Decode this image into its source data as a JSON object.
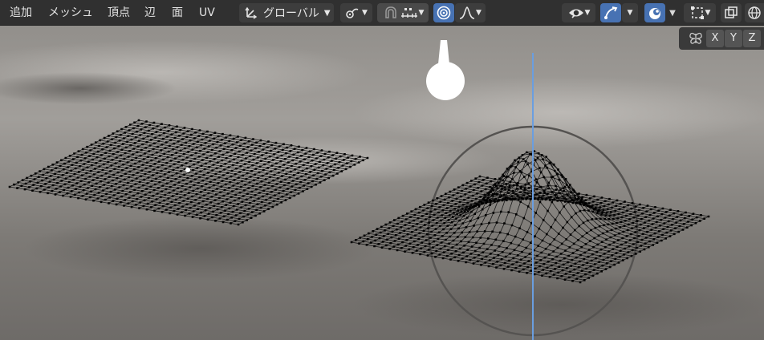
{
  "menu": {
    "add": "追加",
    "mesh": "メッシュ",
    "vertex": "頂点",
    "edge": "辺",
    "face": "面",
    "uv": "UV"
  },
  "toolbar": {
    "transform_orientation": "グローバル"
  },
  "axis_gizmo": {
    "x": "X",
    "y": "Y",
    "z": "Z"
  },
  "colors": {
    "header_bg": "#303030",
    "button_bg": "#3d3d3d",
    "active_button": "#4772b3",
    "axis_line": "#6a9ee0",
    "selected_vertex": "#ffffff"
  },
  "icons": {
    "transform_pivot": "pivot-icon",
    "snap": "snap-magnet-icon",
    "snap_increment": "snap-increment-icon",
    "proportional_edit": "proportional-edit-icon",
    "falloff": "smooth-falloff-icon",
    "visibility": "eye-icon",
    "gizmo": "gizmo-arrow-icon",
    "overlays": "overlay-icon",
    "mesh_edit_overlay": "mesh-select-icon",
    "xray": "xray-icon",
    "shading_wire": "wireframe-sphere-icon",
    "mirror": "butterfly-mirror-icon"
  }
}
